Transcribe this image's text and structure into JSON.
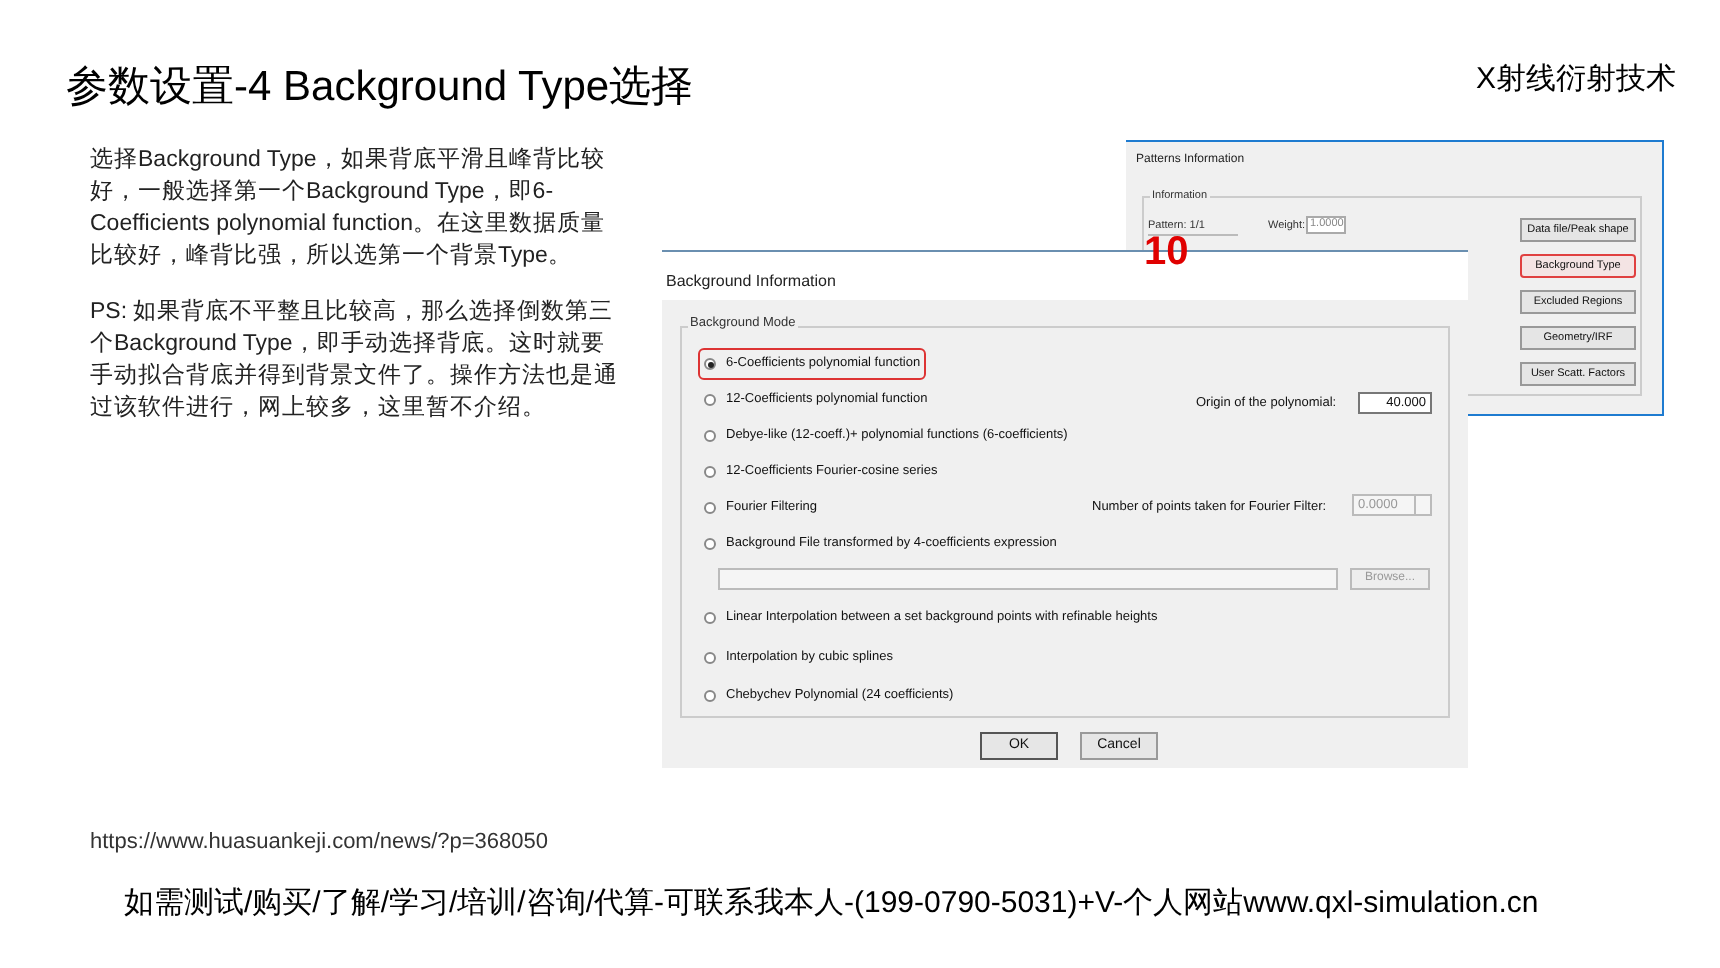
{
  "title": "参数设置-4 Background Type选择",
  "subtitle": "X射线衍射技术",
  "paragraphs": [
    "选择Background Type，如果背底平滑且峰背比较好，一般选择第一个Background Type，即6-Coefficients polynomial function。在这里数据质量比较好，峰背比强，所以选第一个背景Type。",
    "PS: 如果背底不平整且比较高，那么选择倒数第三个Background Type，即手动选择背底。这时就要手动拟合背底并得到背景文件了。操作方法也是通过该软件进行，网上较多，这里暂不介绍。"
  ],
  "source_url": "https://www.huasuankeji.com/news/?p=368050",
  "footer": "如需测试/购买/了解/学习/培训/咨询/代算-可联系我本人-(199-0790-5031)+V-个人网站www.qxl-simulation.cn",
  "patterns_window": {
    "title": "Patterns Information",
    "group": "Information",
    "pattern": "Pattern: 1/1",
    "weight_label": "Weight:",
    "weight_value": "1.0000",
    "buttons": [
      {
        "label": "Data file/Peak shape",
        "highlighted": false
      },
      {
        "label": "Background Type",
        "highlighted": true
      },
      {
        "label": "Excluded Regions",
        "highlighted": false
      },
      {
        "label": "Geometry/IRF",
        "highlighted": false
      },
      {
        "label": "User Scatt. Factors",
        "highlighted": false
      }
    ]
  },
  "step_label": "10",
  "background_dialog": {
    "title": "Background Information",
    "group": "Background Mode",
    "options": [
      {
        "label": "6-Coefficients polynomial function",
        "selected": true,
        "highlighted": true
      },
      {
        "label": "12-Coefficients polynomial function",
        "selected": false,
        "highlighted": false,
        "extra": {
          "kind": "number",
          "label": "Origin of the polynomial:",
          "value": "40.000"
        }
      },
      {
        "label": "Debye-like (12-coeff.)+ polynomial functions (6-coefficients)",
        "selected": false,
        "highlighted": false
      },
      {
        "label": "12-Coefficients Fourier-cosine series",
        "selected": false,
        "highlighted": false
      },
      {
        "label": "Fourier Filtering",
        "selected": false,
        "highlighted": false,
        "extra": {
          "kind": "spinner",
          "label": "Number of points taken for Fourier Filter:",
          "value": "0.0000"
        }
      },
      {
        "label": "Background File transformed by 4-coefficients expression",
        "selected": false,
        "highlighted": false,
        "extra": {
          "kind": "file",
          "button": "Browse..."
        }
      },
      {
        "label": "Linear Interpolation between a set background points with refinable heights",
        "selected": false,
        "highlighted": false
      },
      {
        "label": "Interpolation by cubic splines",
        "selected": false,
        "highlighted": false
      },
      {
        "label": "Chebychev Polynomial (24 coefficients)",
        "selected": false,
        "highlighted": false
      }
    ],
    "buttons": [
      "OK",
      "Cancel"
    ]
  }
}
